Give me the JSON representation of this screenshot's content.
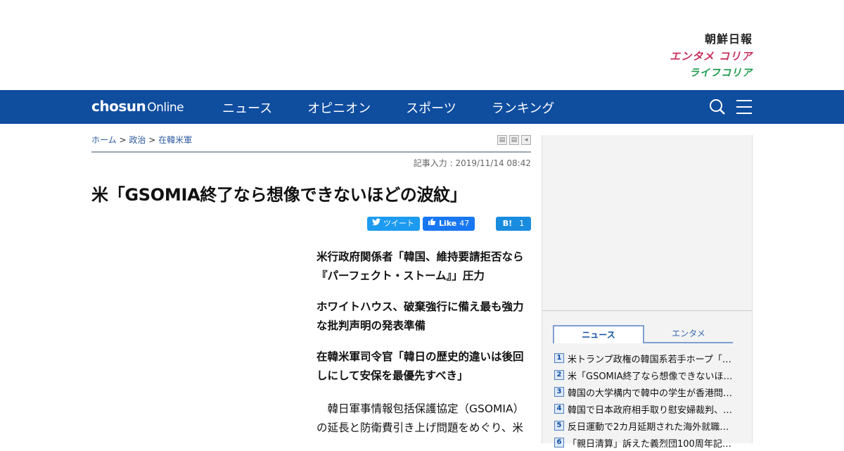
{
  "brands": {
    "chosun": "朝鮮日報",
    "entame": "エンタメ コリア",
    "life": "ライフコリア"
  },
  "nav": {
    "logo_main": "chosun",
    "logo_sub": "Online",
    "items": [
      "ニュース",
      "オピニオン",
      "スポーツ",
      "ランキング"
    ],
    "icons": [
      "search-icon",
      "menu-icon"
    ]
  },
  "breadcrumb": {
    "home": "ホーム",
    "sep": ">",
    "category": "政治",
    "subcategory": "在韓米軍"
  },
  "article": {
    "date": "記事入力 : 2019/11/14 08:42",
    "headline": "米「GSOMIA終了なら想像できないほどの波紋」",
    "subheads": [
      "米行政府関係者「韓国、維持要請拒否なら『パーフェクト・ストーム』」圧力",
      "ホワイトハウス、破棄強行に備え最も強力な批判声明の発表準備",
      "在韓米軍司令官「韓日の歴史的違いは後回しにして安保を最優先すべき」"
    ],
    "body": "韓日軍事情報包括保護協定（GSOMIA）の延長と防衛費引き上げ問題をめぐり、米"
  },
  "share": {
    "tweet": "ツイート",
    "like": "Like",
    "like_count": "47",
    "hatena": "B!",
    "hatena_count": "1"
  },
  "ranking": {
    "tabs": [
      "ニュース",
      "エンタメ"
    ],
    "active_tab": "ニュース",
    "items": [
      {
        "num": "1",
        "title": "米トランプ政権の韓国系若手ホープ「…"
      },
      {
        "num": "2",
        "title": "米「GSOMIA終了なら想像できないほ…"
      },
      {
        "num": "3",
        "title": "韓国の大学構内で韓中の学生が香港問…"
      },
      {
        "num": "4",
        "title": "韓国で日本政府相手取り慰安婦裁判、…"
      },
      {
        "num": "5",
        "title": "反日運動で2カ月延期された海外就職…"
      },
      {
        "num": "6",
        "title": "「親日清算」訴えた義烈団100周年記…"
      }
    ]
  },
  "colors": {
    "nav_bg": "#0f4d9f",
    "entame": "#c8305a",
    "life": "#1a9a4a",
    "twitter": "#1d9bf0",
    "facebook": "#1877f2"
  }
}
